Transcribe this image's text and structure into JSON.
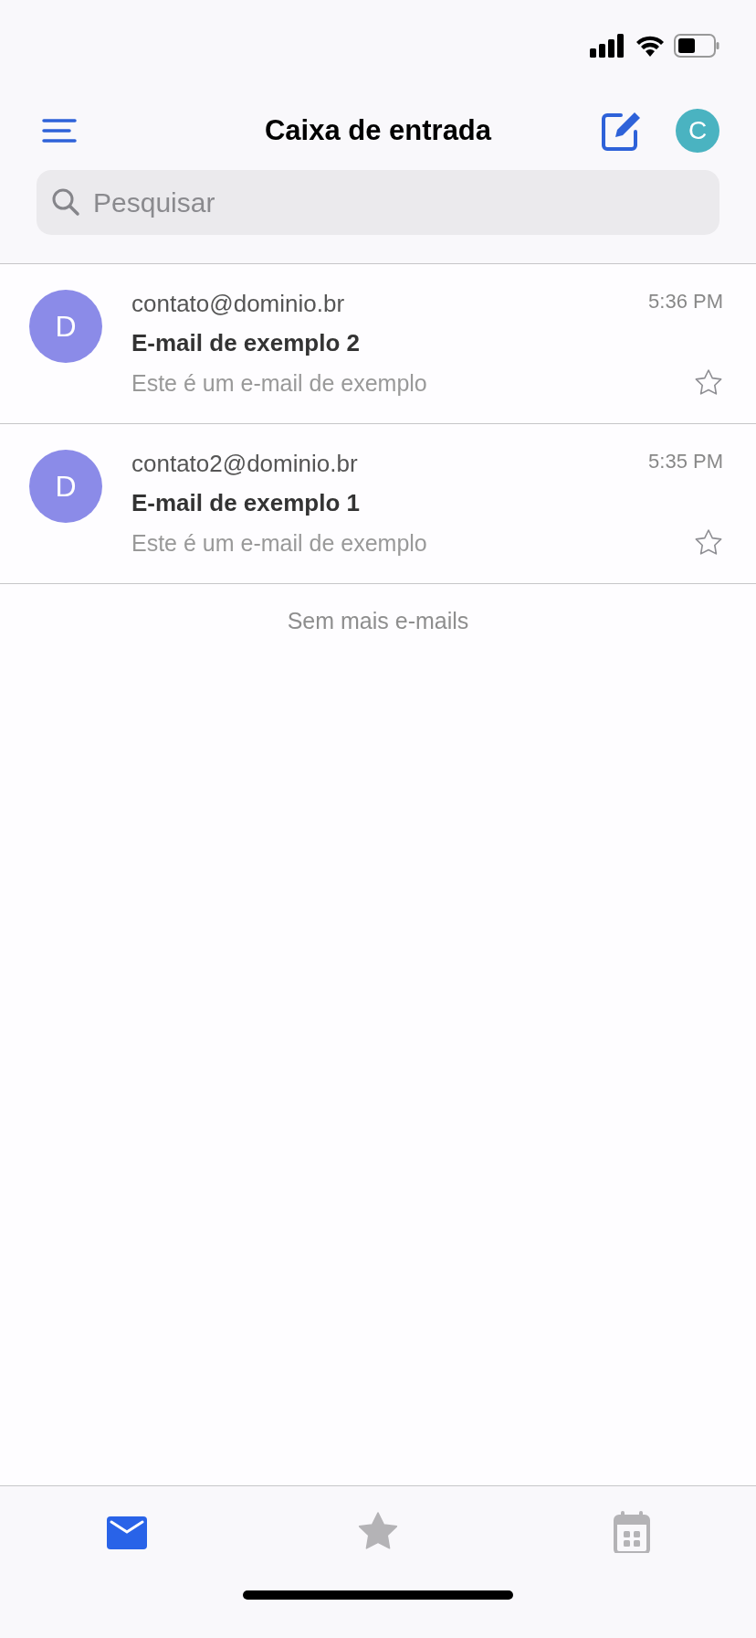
{
  "header": {
    "title": "Caixa de entrada",
    "account_initial": "C"
  },
  "search": {
    "placeholder": "Pesquisar"
  },
  "emails": [
    {
      "avatar": "D",
      "sender": "contato@dominio.br",
      "time": "5:36 PM",
      "subject": "E-mail de exemplo 2",
      "preview": "Este é um e-mail de exemplo",
      "starred": false
    },
    {
      "avatar": "D",
      "sender": "contato2@dominio.br",
      "time": "5:35 PM",
      "subject": "E-mail de exemplo 1",
      "preview": "Este é um e-mail de exemplo",
      "starred": false
    }
  ],
  "end_message": "Sem mais e-mails",
  "tabs": [
    {
      "kind": "mail",
      "selected": true
    },
    {
      "kind": "starred",
      "selected": false
    },
    {
      "kind": "calendar",
      "selected": false
    }
  ]
}
